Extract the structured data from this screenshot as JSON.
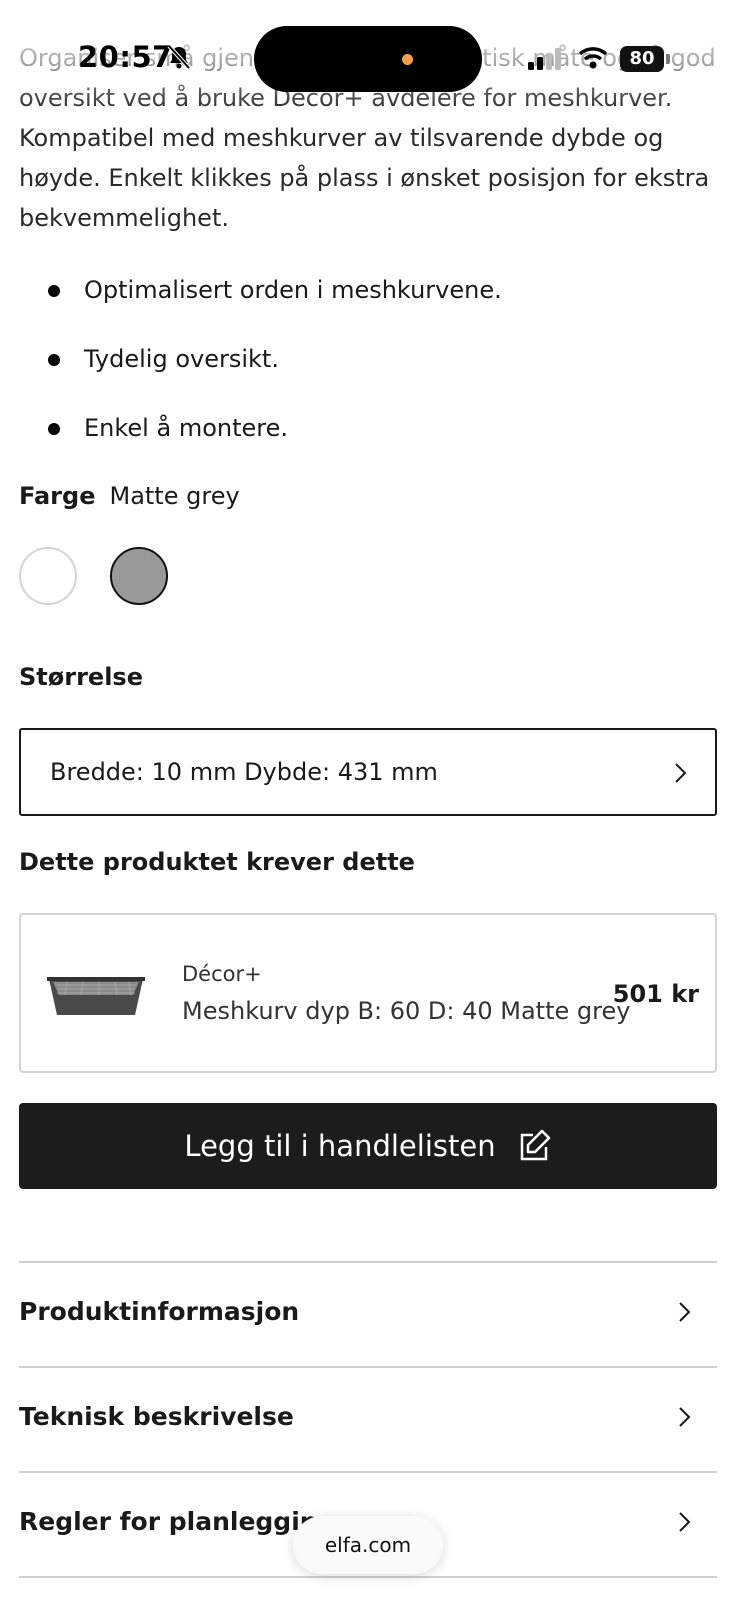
{
  "status": {
    "time": "20:57",
    "battery": "80"
  },
  "product": {
    "description": "Organiser små gjenstander på en praktisk måte og få god oversikt ved å bruke Décor+ avdelere for meshkurver. Kompatibel med meshkurver av tilsvarende dybde og høyde. Enkelt klikkes på plass i ønsket posisjon for ekstra bekvemmelighet.",
    "bullets": [
      "Optimalisert orden i meshkurvene.",
      "Tydelig oversikt.",
      "Enkel å montere."
    ]
  },
  "color": {
    "label": "Farge",
    "selected": "Matte grey",
    "swatches": [
      {
        "name": "white",
        "hex": "#ffffff"
      },
      {
        "name": "Matte grey",
        "hex": "#999999"
      }
    ]
  },
  "size": {
    "label": "Størrelse",
    "value": "Bredde: 10 mm Dybde: 431 mm"
  },
  "required": {
    "title": "Dette produktet krever dette",
    "brand": "Décor+",
    "name": "Meshkurv dyp B: 60 D: 40 Matte grey",
    "price": "501 kr"
  },
  "cta": {
    "label": "Legg til i handlelisten"
  },
  "accordion": [
    "Produktinformasjon",
    "Teknisk beskrivelse",
    "Regler for planlegging"
  ],
  "browser": {
    "url": "elfa.com"
  },
  "colors": {
    "button_bg": "#1c1c1c",
    "swatch_grey": "#999999",
    "island_dot": "#f5a04a"
  }
}
